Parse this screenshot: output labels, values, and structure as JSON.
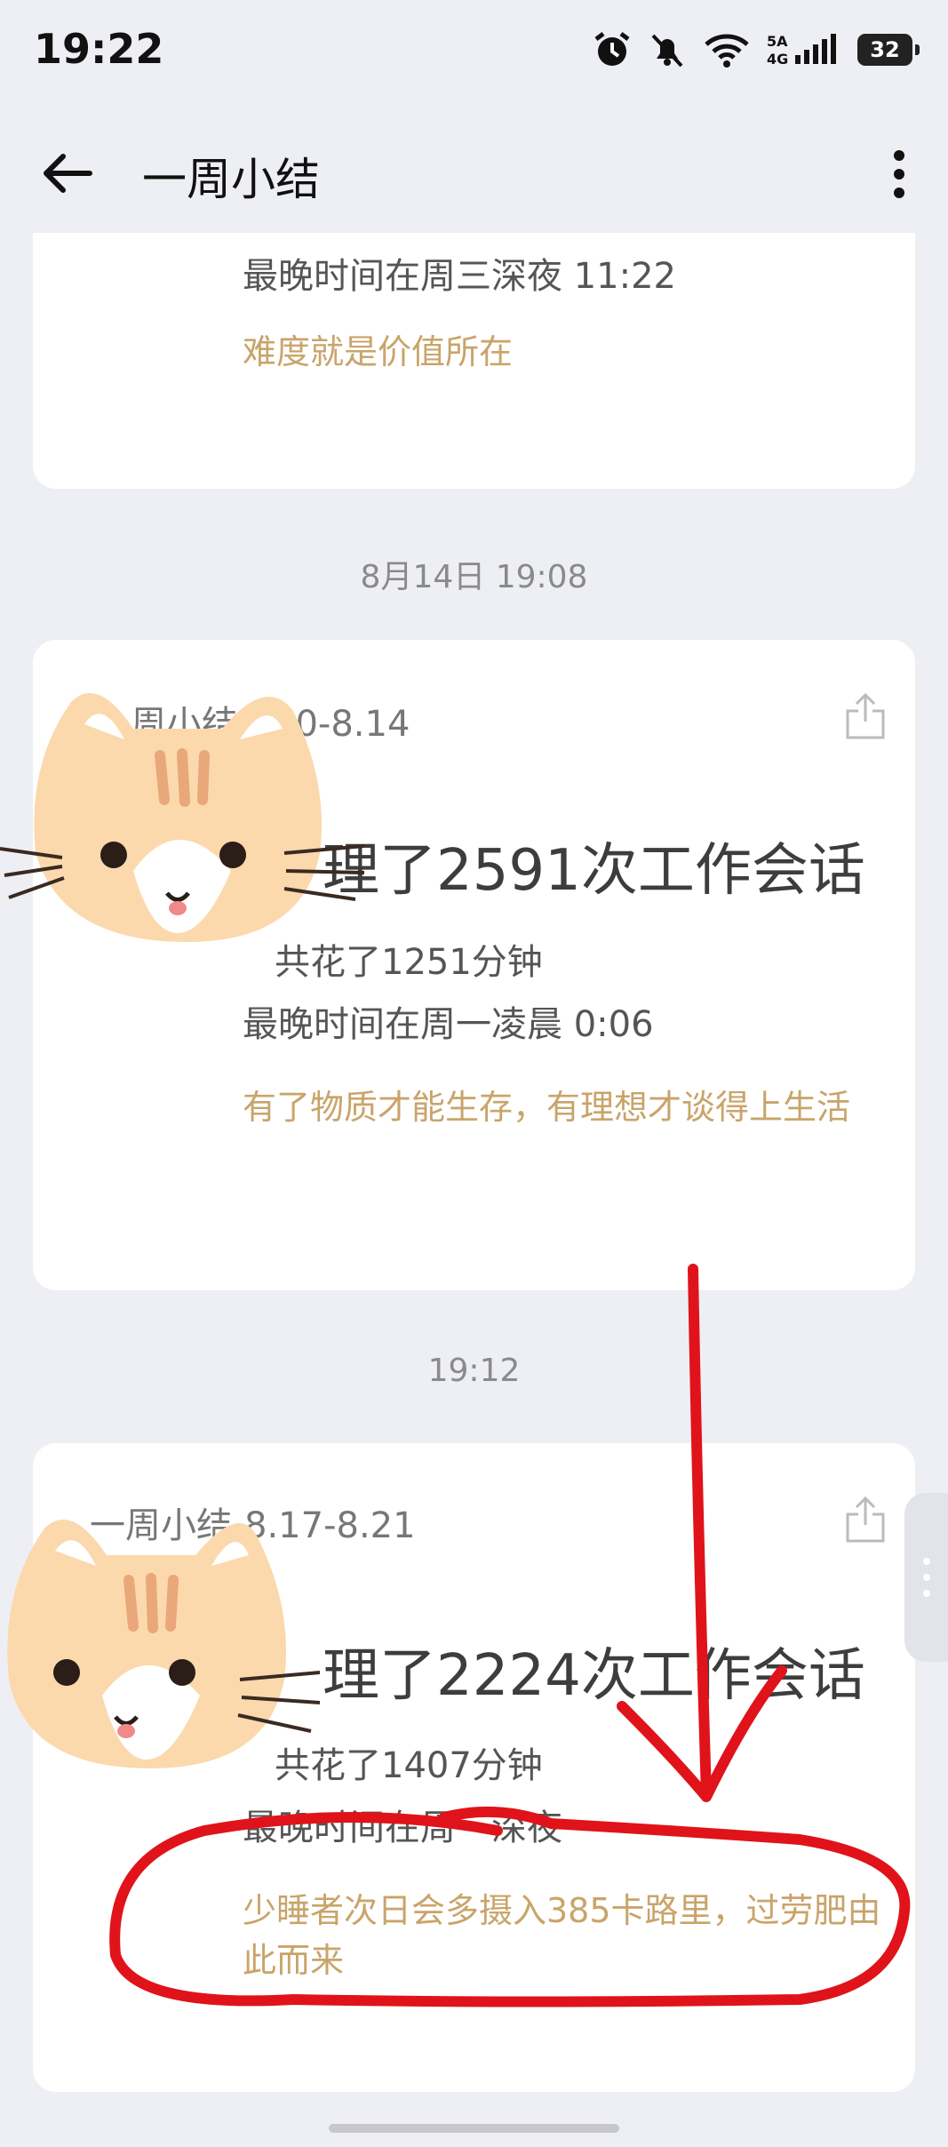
{
  "status": {
    "time": "19:22",
    "network": "5A 4G",
    "battery": "32"
  },
  "header": {
    "title": "一周小结"
  },
  "card0": {
    "latest": "最晚时间在周三深夜 11:22",
    "quote": "难度就是价值所在"
  },
  "sep1": "8月14日  19:08",
  "card1": {
    "head": "周小结",
    "head_range": "10-8.14",
    "big": "理了2591次工作会话",
    "total": "共花了1251分钟",
    "latest": "最晚时间在周一凌晨 0:06",
    "quote": "有了物质才能生存，有理想才谈得上生活"
  },
  "sep2": "19:12",
  "card2": {
    "head": "一周小结",
    "head_range": "8.17-8.21",
    "big": "理了2224次工作会话",
    "total": "共花了1407分钟",
    "latest": "最晚时间在周",
    "latest_tail": "深夜",
    "quote": "少睡者次日会多摄入385卡路里，过劳肥由此而来"
  },
  "icons": {
    "alarm": "alarm-icon",
    "mute": "bell-off-icon",
    "wifi": "wifi-icon",
    "signal": "signal-icon",
    "back": "arrow-left-icon",
    "more": "more-vertical-icon",
    "share": "share-icon"
  },
  "colors": {
    "quote": "#c9a46a",
    "annotation": "#e0131a",
    "background": "#eeeff4"
  }
}
